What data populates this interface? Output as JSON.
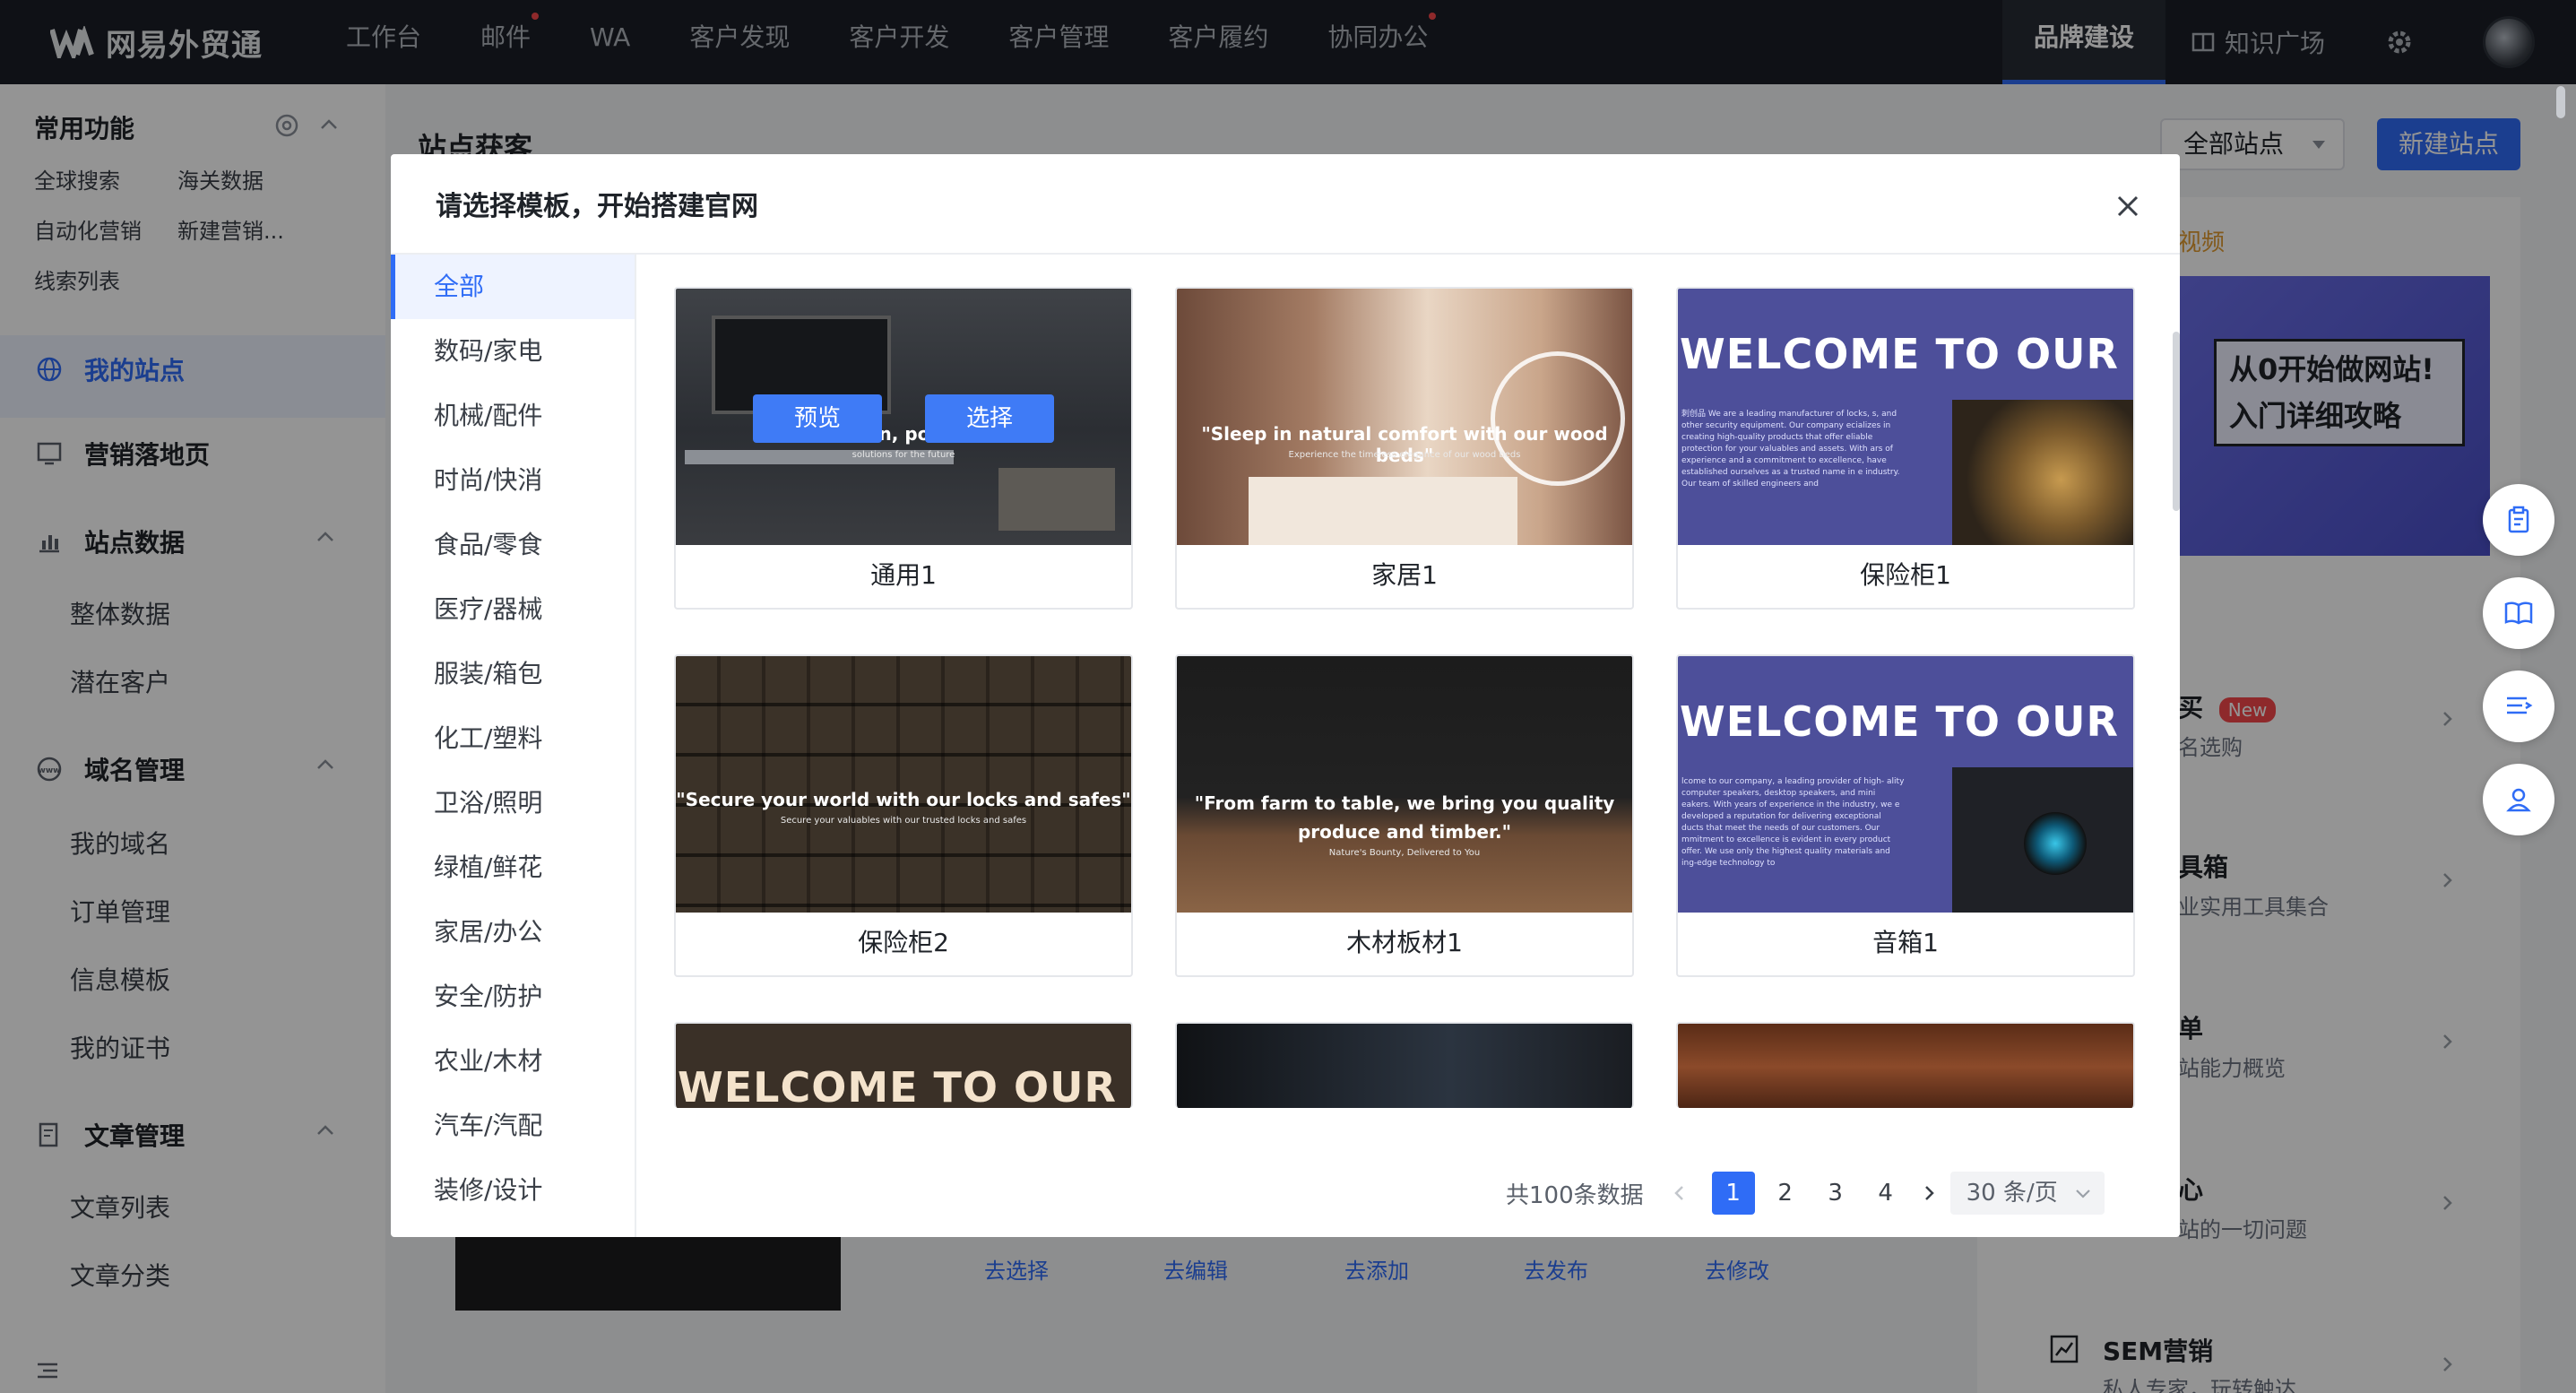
{
  "topnav": {
    "brand": "网易外贸通",
    "items": [
      {
        "label": "工作台",
        "dot": false
      },
      {
        "label": "邮件",
        "dot": true
      },
      {
        "label": "WA",
        "dot": false
      },
      {
        "label": "客户发现",
        "dot": false
      },
      {
        "label": "客户开发",
        "dot": false
      },
      {
        "label": "客户管理",
        "dot": false
      },
      {
        "label": "客户履约",
        "dot": false
      },
      {
        "label": "协同办公",
        "dot": true
      }
    ],
    "active_tab": "品牌建设",
    "knowledge": "知识广场"
  },
  "sidebar": {
    "quick_title": "常用功能",
    "quick_items": [
      "全球搜索",
      "海关数据",
      "自动化营销",
      "新建营销...",
      "线索列表"
    ],
    "my_sites": "我的站点",
    "landing": "营销落地页",
    "site_data": {
      "title": "站点数据",
      "items": [
        "整体数据",
        "潜在客户"
      ]
    },
    "domain": {
      "title": "域名管理",
      "items": [
        "我的域名",
        "订单管理",
        "信息模板",
        "我的证书"
      ]
    },
    "article": {
      "title": "文章管理",
      "items": [
        "文章列表",
        "文章分类"
      ]
    }
  },
  "background": {
    "page_title": "站点获客",
    "all_sites": "全部站点",
    "new_site": "新建站点",
    "video_tag": "视频",
    "video_banner": [
      "从0开始做网站!",
      "入门详细攻略"
    ],
    "right_items": [
      {
        "title": "买",
        "badge": "New",
        "sub": "名选购"
      },
      {
        "title": "具箱",
        "sub": "业实用工具集合"
      },
      {
        "title": "单",
        "sub": "站能力概览"
      },
      {
        "title": "心",
        "sub": "站的一切问题"
      },
      {
        "title": "SEM营销",
        "sub": "私人专家，玩转触达"
      }
    ],
    "bottom_links": [
      "去选择",
      "去编辑",
      "去添加",
      "去发布",
      "去修改"
    ]
  },
  "modal": {
    "title": "请选择模板，开始搭建官网",
    "categories": [
      "全部",
      "数码/家电",
      "机械/配件",
      "时尚/快消",
      "食品/零食",
      "医疗/器械",
      "服装/箱包",
      "化工/塑料",
      "卫浴/照明",
      "绿植/鲜花",
      "家居/办公",
      "安全/防护",
      "农业/木材",
      "汽车/汽配",
      "装修/设计"
    ],
    "active_category": "全部",
    "preview_label": "预览",
    "select_label": "选择",
    "templates": [
      {
        "name": "通用1",
        "quote": "\"Dri          n, po                ss.\"",
        "sub": "solutions for the future"
      },
      {
        "name": "家居1",
        "quote": "\"Sleep in natural comfort with our wood beds\"",
        "sub": "Experience the timeless elegance of our wood beds"
      },
      {
        "name": "保险柜1",
        "welcome": "WELCOME TO OUR HO",
        "para": "刺创品 We are a leading manufacturer of locks, s, and other security equipment. Our company ecializes in creating high-quality products that offer eliable protection for your valuables and assets. With ars of experience and a commitment to excellence, have established ourselves as a trusted name in e industry. Our team of skilled engineers and"
      },
      {
        "name": "保险柜2",
        "quote": "\"Secure your world with our locks and safes\"",
        "sub": "Secure your valuables with our trusted locks and safes"
      },
      {
        "name": "木材板材1",
        "quote": "\"From farm to table, we bring you quality produce and timber.\"",
        "sub": "Nature's Bounty, Delivered to You"
      },
      {
        "name": "音箱1",
        "welcome": "WELCOME TO OUR HO",
        "para": "lcome to our company, a leading provider of high- ality computer speakers, desktop speakers, and mini eakers. With years of experience in the industry, we e developed a reputation for delivering exceptional ducts that meet the needs of our customers. Our mmitment to excellence is evident in every product offer. We use only the highest quality materials and ing-edge technology to"
      },
      {
        "name": "",
        "welcome": "WELCOME TO OUR HO"
      },
      {
        "name": ""
      },
      {
        "name": ""
      }
    ],
    "pager": {
      "total": "共100条数据",
      "pages": [
        "1",
        "2",
        "3",
        "4"
      ],
      "current": "1",
      "page_size": "30 条/页"
    }
  },
  "colors": {
    "accent": "#2f6cf6",
    "topnav_bg": "#1a1e26",
    "modal_bg": "#ffffff"
  }
}
